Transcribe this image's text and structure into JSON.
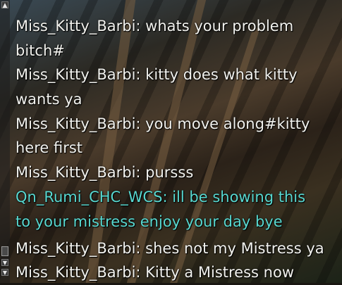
{
  "chat": {
    "lines": [
      {
        "text": "Miss_Kitty_Barbi: whats your problem",
        "color": "#f2f2ee"
      },
      {
        "text": "bitch#",
        "color": "#f2f2ee"
      },
      {
        "text": "Miss_Kitty_Barbi: kitty does what kitty",
        "color": "#f2f2ee"
      },
      {
        "text": "wants ya",
        "color": "#f2f2ee"
      },
      {
        "text": "Miss_Kitty_Barbi: you move along#kitty",
        "color": "#f2f2ee"
      },
      {
        "text": "here first",
        "color": "#f2f2ee"
      },
      {
        "text": "Miss_Kitty_Barbi: pursss",
        "color": "#f2f2ee"
      },
      {
        "text": "Qn_Rumi_CHC_WCS: ill be showing this",
        "color": "#58d8d0"
      },
      {
        "text": "to your mistress enjoy your day bye",
        "color": "#58d8d0"
      },
      {
        "text": "Miss_Kitty_Barbi: shes not my Mistress ya",
        "color": "#f2f2ee"
      },
      {
        "text": "Miss_Kitty_Barbi: Kitty a Mistress now",
        "color": "#f2f2ee"
      }
    ]
  },
  "scrollbar": {
    "up_icon": "▲",
    "down_icon": "▼",
    "bottom_icon": "▼"
  }
}
